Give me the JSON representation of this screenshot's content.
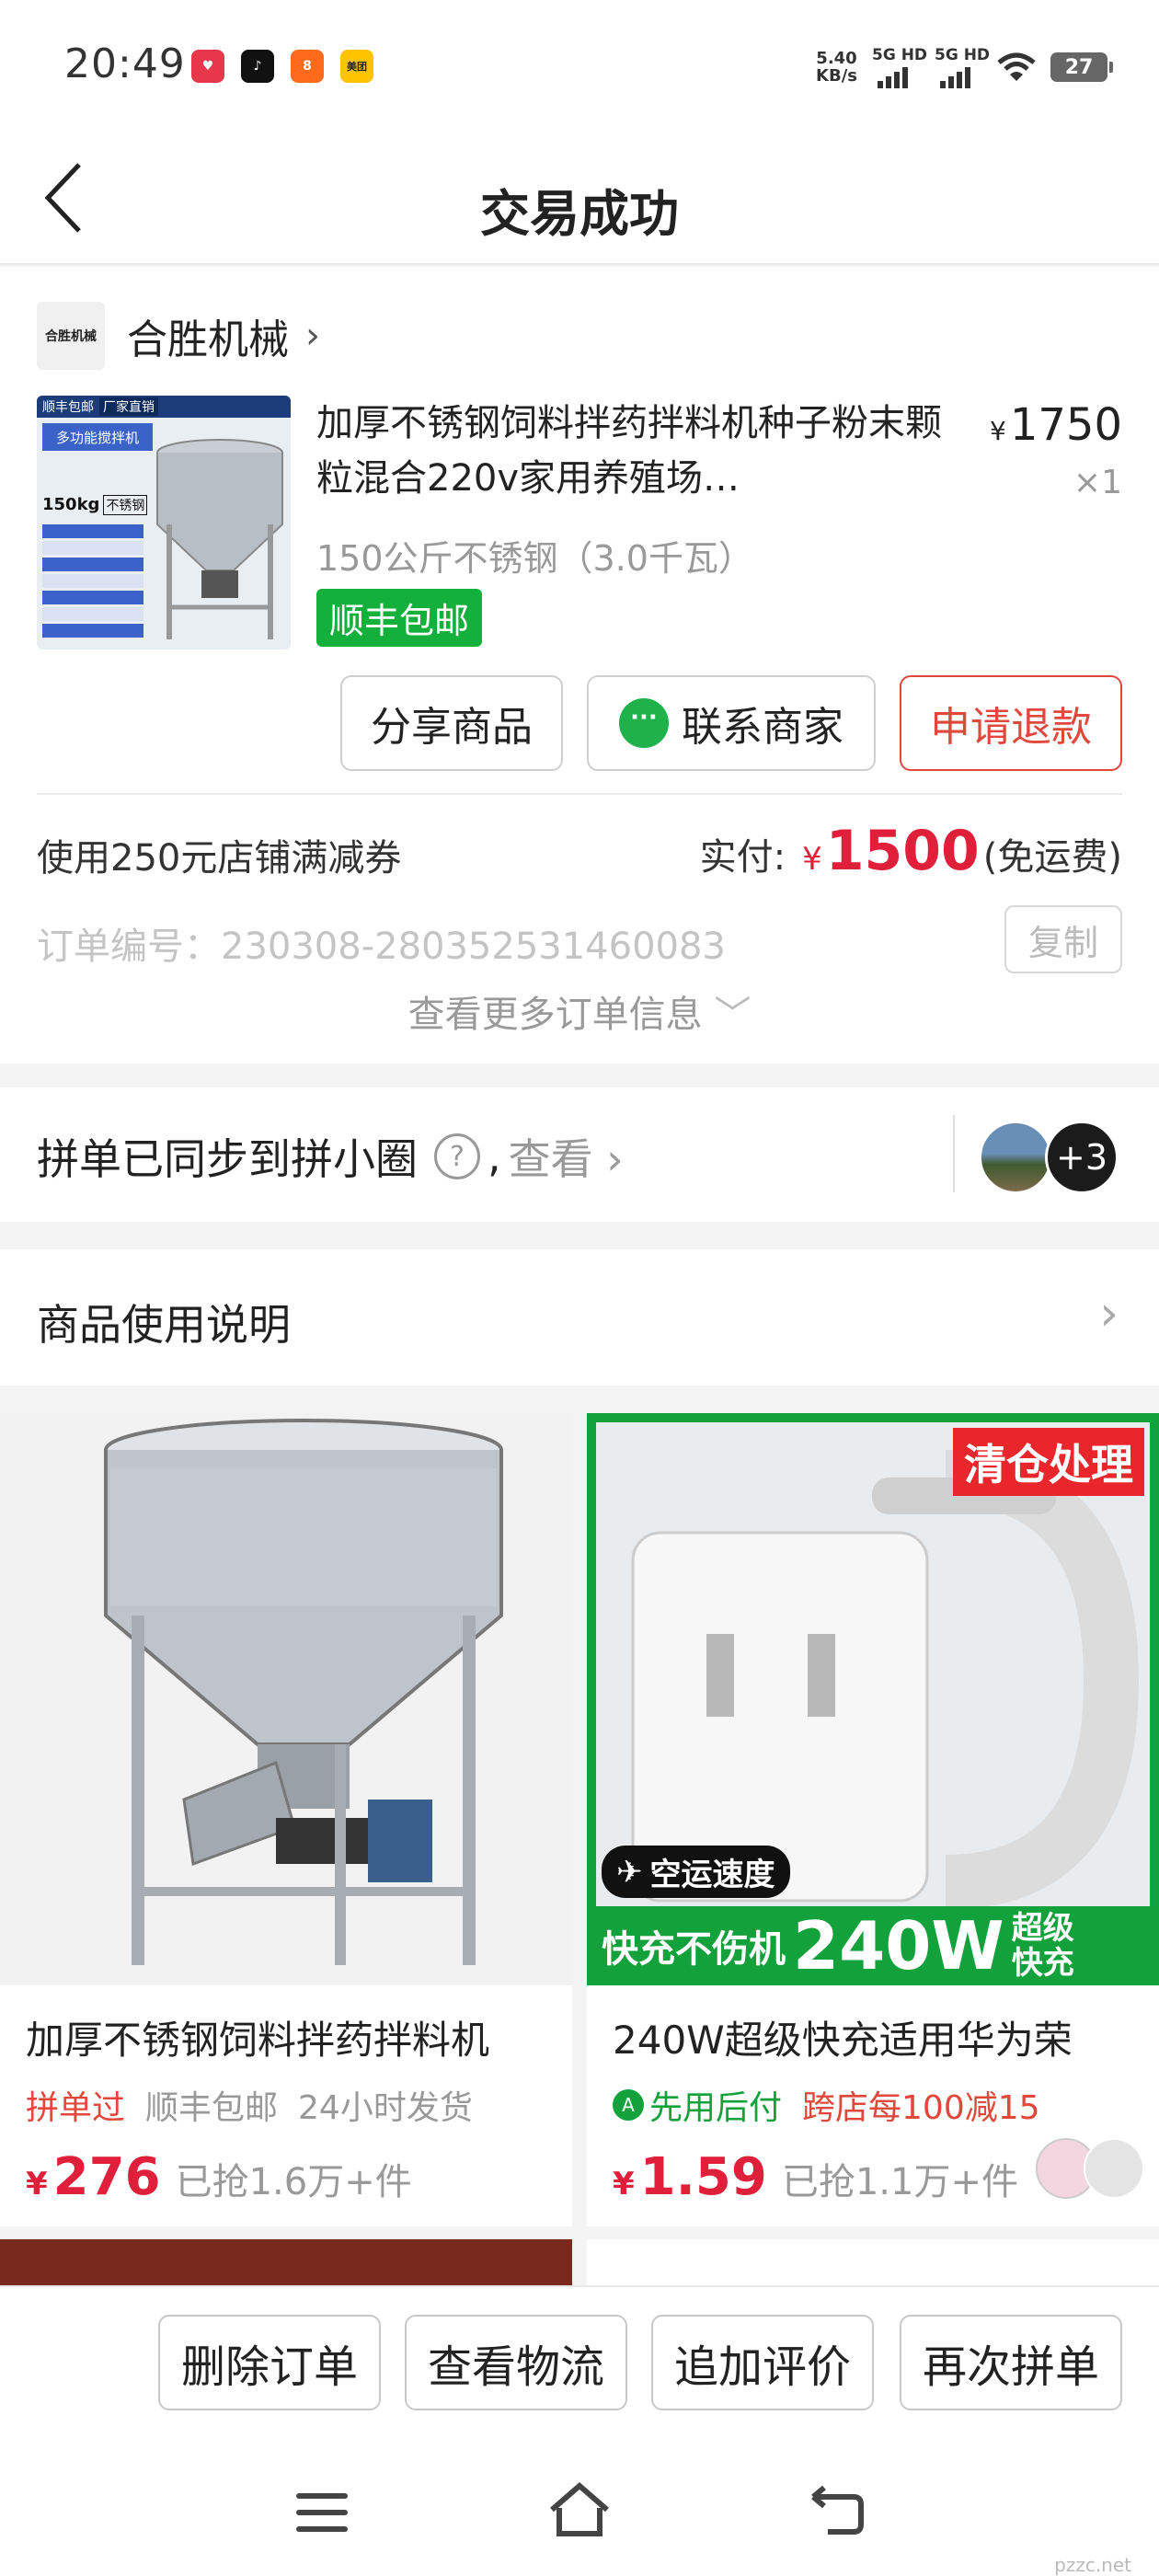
{
  "status_bar": {
    "time": "20:49",
    "apps": [
      {
        "name": "app-icon-red",
        "color": "#e8374a",
        "text": "♥"
      },
      {
        "name": "tiktok-icon",
        "color": "#111111",
        "text": "♪"
      },
      {
        "name": "app-icon-orange",
        "color": "#ff6a1a",
        "text": "8"
      },
      {
        "name": "meituan-icon",
        "color": "#ffc300",
        "text": "美团"
      }
    ],
    "speed_value": "5.40",
    "speed_unit": "KB/s",
    "signal1_label": "5G HD",
    "signal2_label": "5G HD",
    "battery": "27"
  },
  "header": {
    "title": "交易成功"
  },
  "shop": {
    "name": "合胜机械",
    "logo_text": "合胜机械"
  },
  "product": {
    "title": "加厚不锈钢饲料拌药拌料机种子粉末颗粒混合220v家用养殖场…",
    "price_symbol": "¥",
    "price": "1750",
    "quantity": "×1",
    "spec": "150公斤不锈钢（3.0千瓦）",
    "shipping_tag": "顺丰包邮",
    "thumb_labels": [
      "顺丰包邮",
      "厂家直销",
      "多功能搅拌机",
      "150kg",
      "不锈钢"
    ]
  },
  "actions": {
    "share": "分享商品",
    "contact": "联系商家",
    "refund": "申请退款"
  },
  "payment": {
    "coupon": "使用250元店铺满减券",
    "paid_label": "实付:",
    "paid_symbol": "¥",
    "paid_amount": "1500",
    "paid_note": "(免运费)"
  },
  "order": {
    "number_text": "订单编号：230308-280352531460083",
    "copy": "复制",
    "more_info": "查看更多订单信息"
  },
  "sync": {
    "text": "拼单已同步到拼小圈",
    "question": "?",
    "comma": ",",
    "view": "查看",
    "extra_count": "+3"
  },
  "usage": {
    "label": "商品使用说明"
  },
  "recommendations": [
    {
      "title": "加厚不锈钢饲料拌药拌料机",
      "tags": [
        "拼单过",
        "顺丰包邮",
        "24小时发货"
      ],
      "price_symbol": "¥",
      "price": "276",
      "sold": "已抢1.6万+件"
    },
    {
      "title": "240W超级快充适用华为荣",
      "badge_green": "先用后付",
      "tag_red": "跨店每100减15",
      "price_symbol": "¥",
      "price": "1.59",
      "sold": "已抢1.1万+件",
      "banner_top": "清仓处理",
      "banner_air": "空运速度",
      "banner_bottom_left": "快充不伤机",
      "banner_watt": "240W",
      "banner_super": "超级",
      "banner_fast": "快充"
    }
  ],
  "bottom_actions": {
    "delete": "删除订单",
    "logistics": "查看物流",
    "review": "追加评价",
    "reorder": "再次拼单"
  },
  "watermark": {
    "text": "pzzc.net"
  },
  "colors": {
    "accent_red": "#e0203b",
    "green": "#13b13b"
  }
}
